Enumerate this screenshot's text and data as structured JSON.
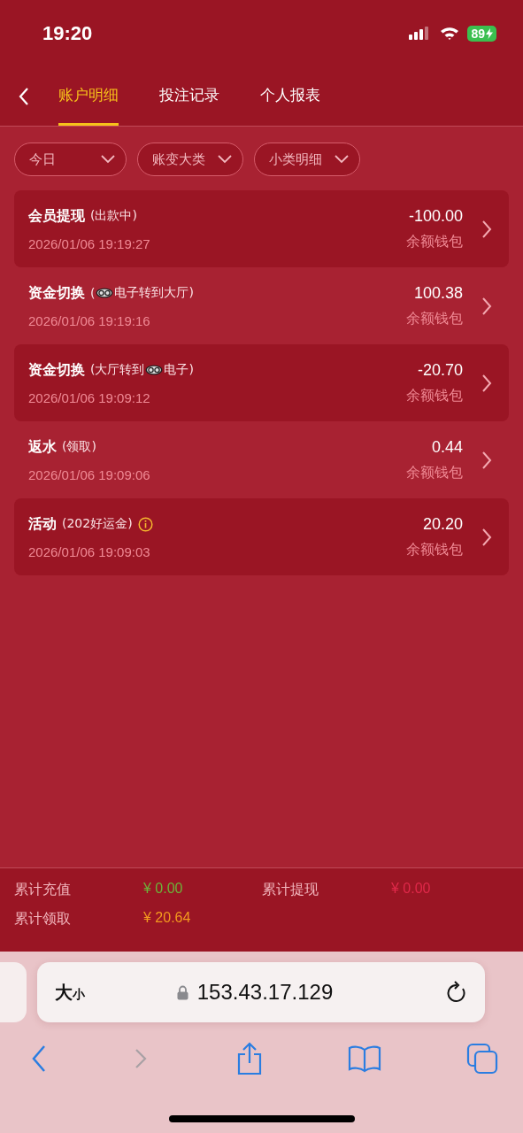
{
  "status_bar": {
    "time": "19:20",
    "battery": "89"
  },
  "tabs": [
    {
      "label": "账户明细",
      "selected": true
    },
    {
      "label": "投注记录",
      "selected": false
    },
    {
      "label": "个人报表",
      "selected": false
    }
  ],
  "filters": [
    {
      "label": "今日"
    },
    {
      "label": "账变大类"
    },
    {
      "label": "小类明细"
    }
  ],
  "records": [
    {
      "title": "会员提现",
      "note": [
        {
          "kind": "text",
          "text": "(出款中)"
        }
      ],
      "info": false,
      "time": "2026/01/06 19:19:27",
      "amount": "-100.00",
      "wallet": "余额钱包",
      "shaded": true
    },
    {
      "title": "资金切换",
      "note": [
        {
          "kind": "text",
          "text": "("
        },
        {
          "kind": "logo"
        },
        {
          "kind": "text",
          "text": "电子转到大厅)"
        }
      ],
      "info": false,
      "time": "2026/01/06 19:19:16",
      "amount": "100.38",
      "wallet": "余额钱包",
      "shaded": false
    },
    {
      "title": "资金切换",
      "note": [
        {
          "kind": "text",
          "text": "(大厅转到"
        },
        {
          "kind": "logo"
        },
        {
          "kind": "text",
          "text": "电子)"
        }
      ],
      "info": false,
      "time": "2026/01/06 19:09:12",
      "amount": "-20.70",
      "wallet": "余额钱包",
      "shaded": true
    },
    {
      "title": "返水",
      "note": [
        {
          "kind": "text",
          "text": "(领取)"
        }
      ],
      "info": false,
      "time": "2026/01/06 19:09:06",
      "amount": "0.44",
      "wallet": "余额钱包",
      "shaded": false
    },
    {
      "title": "活动",
      "note": [
        {
          "kind": "text",
          "text": "(202好运金)"
        }
      ],
      "info": true,
      "time": "2026/01/06 19:09:03",
      "amount": "20.20",
      "wallet": "余额钱包",
      "shaded": true
    }
  ],
  "summary": [
    {
      "label": "累计充值",
      "value": "¥ 0.00",
      "color": "#6cb33a"
    },
    {
      "label": "累计提现",
      "value": "¥ 0.00",
      "color": "#e0294a"
    },
    {
      "label": "累计领取",
      "value": "¥ 20.64",
      "color": "#f39a1e"
    }
  ],
  "browser": {
    "text_size": "大$_{小}$",
    "url": "153.43.17.129"
  }
}
